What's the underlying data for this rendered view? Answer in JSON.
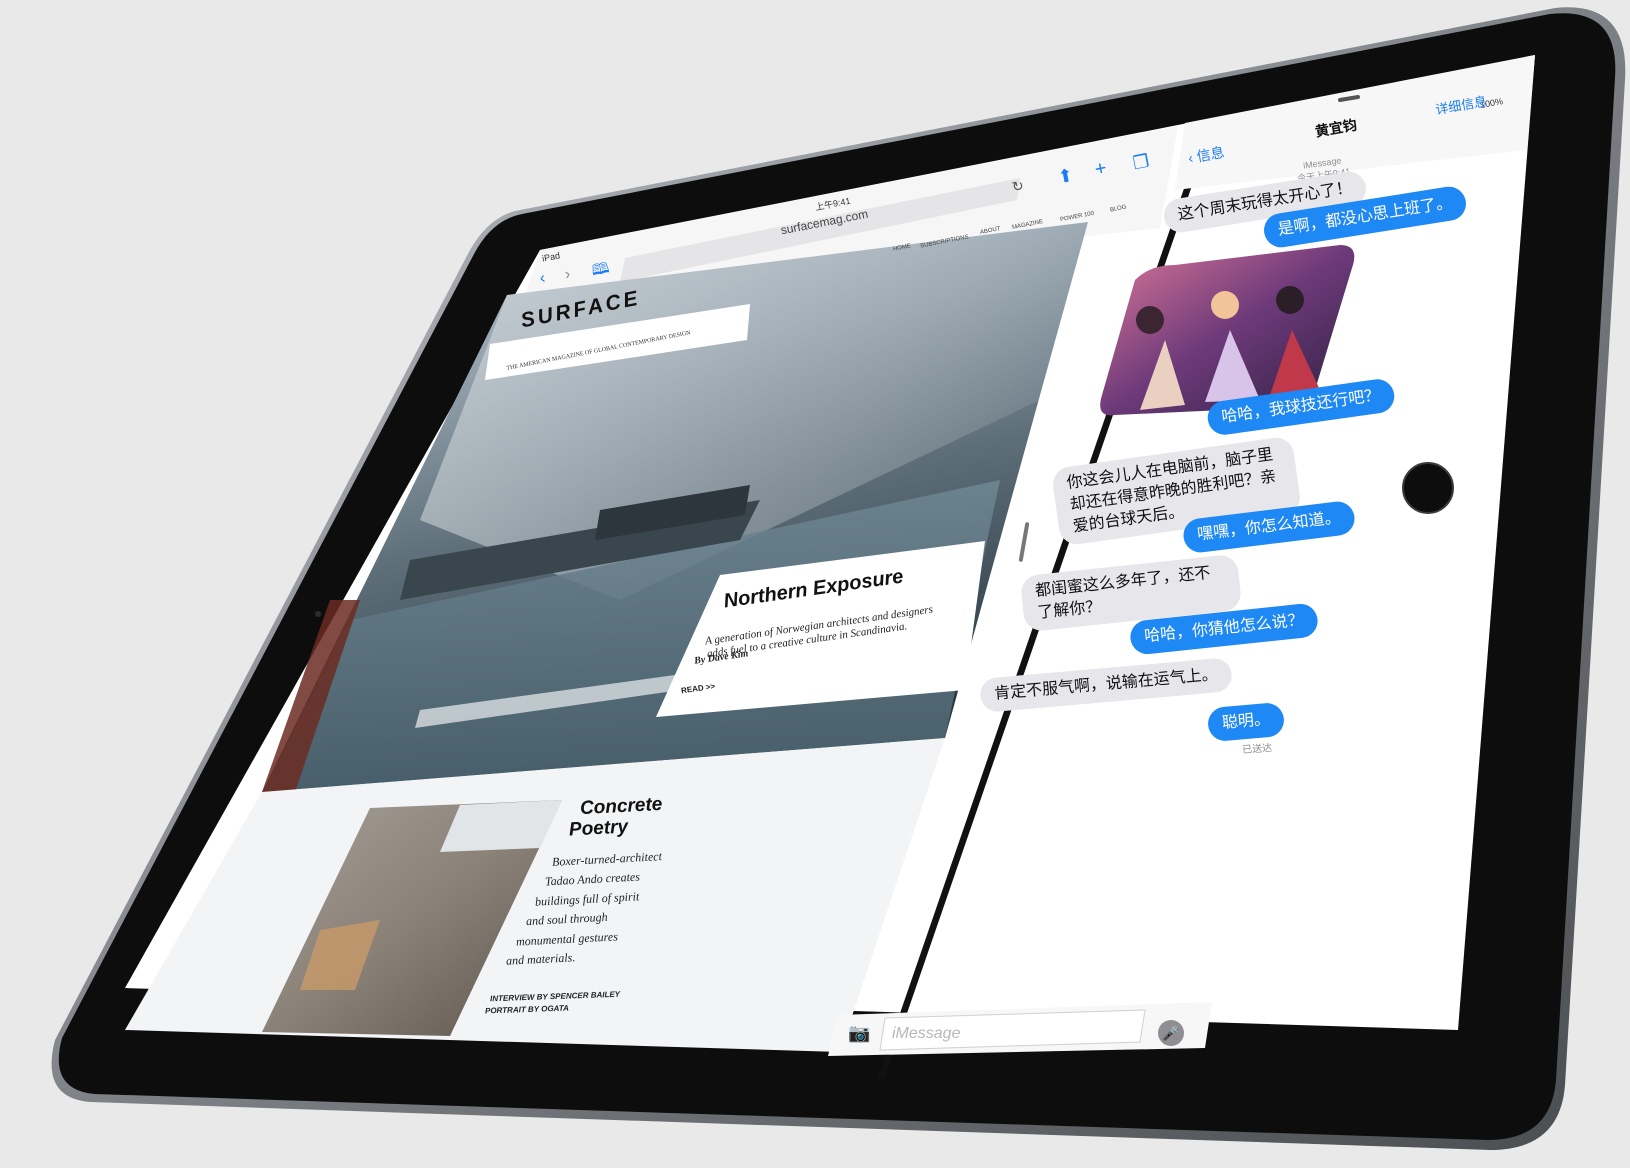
{
  "safari": {
    "status_device": "iPad",
    "status_time": "上午9:41",
    "url": "surfacemag.com",
    "nav_links": [
      "HOME",
      "SUBSCRIPTIONS",
      "ABOUT",
      "MAGAZINE",
      "POWER 100",
      "BLOG"
    ],
    "brand": "SURFACE",
    "tagline": "THE AMERICAN MAGAZINE OF GLOBAL CONTEMPORARY DESIGN",
    "feature": {
      "title": "Northern Exposure",
      "body": "A generation of Norwegian architects and designers adds fuel to a creative culture in Scandinavia.",
      "byline": "By Dave Kim",
      "read": "READ >>"
    },
    "article2": {
      "title_line1": "Concrete",
      "title_line2": "Poetry",
      "body_lines": [
        "Boxer-turned-architect",
        "Tadao Ando creates",
        "buildings full of spirit",
        "and soul through",
        "monumental gestures",
        "and materials."
      ],
      "credit_line1": "INTERVIEW BY SPENCER BAILEY",
      "credit_line2": "PORTRAIT BY OGATA"
    },
    "icons": {
      "back": "chevron-left-icon",
      "forward": "chevron-right-icon",
      "bookmarks": "book-icon",
      "reload": "reload-icon",
      "share": "share-icon",
      "add": "plus-icon",
      "tabs": "tabs-icon"
    }
  },
  "messages": {
    "battery": "100%",
    "back_label": "信息",
    "contact": "黄宜钧",
    "details": "详细信息",
    "service": "iMessage",
    "timestamp": "今天上午9:41",
    "bubbles": [
      {
        "side": "gray",
        "text": "这个周末玩得太开心了！"
      },
      {
        "side": "blue",
        "text": "是啊，都没心思上班了。"
      },
      {
        "side": "blue",
        "text": "哈哈，我球技还行吧？"
      },
      {
        "side": "gray",
        "text": "你这会儿人在电脑前，脑子里却还在得意昨晚的胜利吧？亲爱的台球天后。"
      },
      {
        "side": "blue",
        "text": "嘿嘿，你怎么知道。"
      },
      {
        "side": "gray",
        "text": "都闺蜜这么多年了，还不了解你？"
      },
      {
        "side": "blue",
        "text": "哈哈，你猜他怎么说？"
      },
      {
        "side": "gray",
        "text": "肯定不服气啊，说输在运气上。"
      },
      {
        "side": "blue",
        "text": "聪明。"
      }
    ],
    "delivered": "已送达",
    "input_placeholder": "iMessage",
    "icons": {
      "camera": "camera-icon",
      "mic": "microphone-icon",
      "back": "chevron-left-icon"
    }
  },
  "colors": {
    "background": "#e9e9ea",
    "bezel": "#0d0d0e",
    "ios_blue": "#1e88f5",
    "bubble_gray": "#e6e6eb"
  }
}
